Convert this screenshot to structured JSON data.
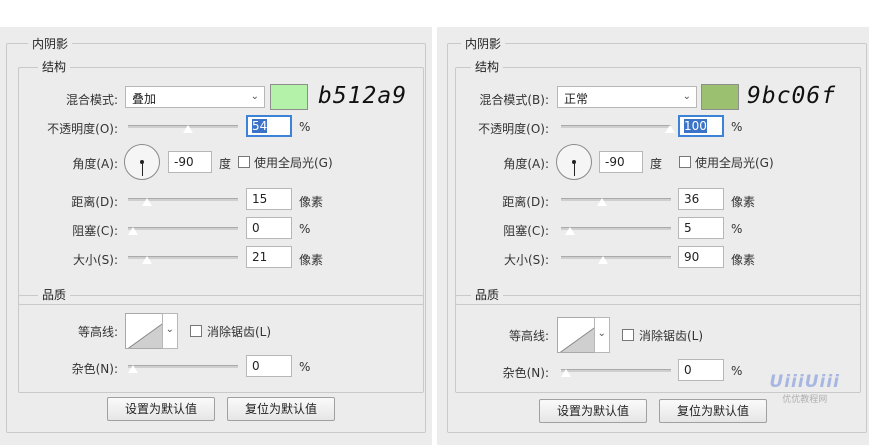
{
  "panels": [
    {
      "title": "内阴影",
      "structure": {
        "title": "结构",
        "blend_mode": {
          "label": "混合模式:",
          "value": "叠加",
          "hotkey": ""
        },
        "color_swatch": "#b5f2a9",
        "color_note": "b512a9",
        "opacity": {
          "label": "不透明度(O):",
          "value": "54",
          "unit": "%",
          "fraction": 0.54
        },
        "angle": {
          "label": "角度(A):",
          "value": "-90",
          "unit": "度"
        },
        "global_light": {
          "label": "使用全局光(G)",
          "checked": false
        },
        "distance": {
          "label": "距离(D):",
          "value": "15",
          "unit": "像素",
          "fraction": 0.06
        },
        "choke": {
          "label": "阻塞(C):",
          "value": "0",
          "unit": "%",
          "fraction": 0.0
        },
        "size": {
          "label": "大小(S):",
          "value": "21",
          "unit": "像素",
          "fraction": 0.08
        }
      },
      "quality": {
        "title": "品质",
        "contour": {
          "label": "等高线:"
        },
        "antialias": {
          "label": "消除锯齿(L)",
          "checked": false
        },
        "noise": {
          "label": "杂色(N):",
          "value": "0",
          "unit": "%",
          "fraction": 0.0
        }
      },
      "buttons": {
        "default": "设置为默认值",
        "reset": "复位为默认值"
      }
    },
    {
      "title": "内阴影",
      "structure": {
        "title": "结构",
        "blend_mode": {
          "label": "混合模式(B):",
          "value": "正常"
        },
        "color_swatch": "#9bc06f",
        "color_note": "9bc06f",
        "opacity": {
          "label": "不透明度(O):",
          "value": "100",
          "unit": "%",
          "fraction": 1.0
        },
        "angle": {
          "label": "角度(A):",
          "value": "-90",
          "unit": "度"
        },
        "global_light": {
          "label": "使用全局光(G)",
          "checked": false
        },
        "distance": {
          "label": "距离(D):",
          "value": "36",
          "unit": "像素",
          "fraction": 0.36
        },
        "choke": {
          "label": "阻塞(C):",
          "value": "5",
          "unit": "%",
          "fraction": 0.05
        },
        "size": {
          "label": "大小(S):",
          "value": "90",
          "unit": "像素",
          "fraction": 0.36
        }
      },
      "quality": {
        "title": "品质",
        "contour": {
          "label": "等高线:"
        },
        "antialias": {
          "label": "消除锯齿(L)",
          "checked": false
        },
        "noise": {
          "label": "杂色(N):",
          "value": "0",
          "unit": "%",
          "fraction": 0.0
        }
      },
      "buttons": {
        "default": "设置为默认值",
        "reset": "复位为默认值"
      }
    }
  ],
  "watermark": {
    "logo": "UiiiUiii",
    "text": "优优教程网"
  }
}
